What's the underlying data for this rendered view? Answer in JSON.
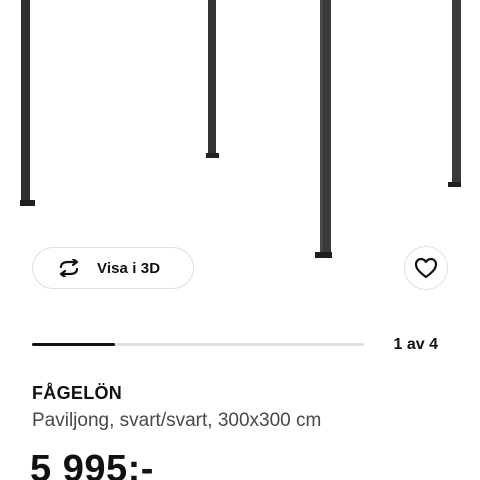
{
  "product_image": {
    "subject": "pavilion-frame",
    "color": "#3b3b3b"
  },
  "view_3d": {
    "label": "Visa i 3D",
    "icon": "rotate-arrows-icon"
  },
  "favorite": {
    "icon": "heart-outline-icon"
  },
  "carousel": {
    "counter": "1 av 4",
    "current": 1,
    "total": 4,
    "progress": 0.25
  },
  "product": {
    "name": "FÅGELÖN",
    "description": "Paviljong, svart/svart, 300x300 cm",
    "price": "5 995:-"
  },
  "colors": {
    "text": "#111111",
    "secondary_text": "#484848",
    "border": "#dfdfdf",
    "track": "#dfdfdf"
  }
}
